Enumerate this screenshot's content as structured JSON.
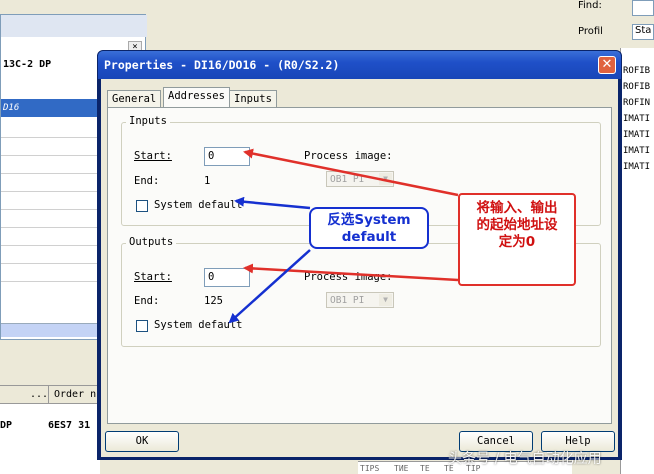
{
  "background": {
    "left_window": {
      "rows": [
        "13C-2 DP",
        "D16"
      ]
    },
    "right_panel": {
      "find_label": "Find:",
      "profile_label": "Profil",
      "profile_value": "Sta",
      "items": [
        "ROFIB",
        "ROFIB",
        "ROFIN",
        "IMATI",
        "IMATI",
        "IMATI",
        "IMATI"
      ]
    },
    "bottom_table": {
      "headers": [
        "...",
        "Order n"
      ],
      "row": [
        "DP",
        "6ES7 31"
      ],
      "extra_row": [
        "TIPS",
        "ТИЕ",
        "ТЕ",
        "ТЕ",
        "TIP"
      ]
    }
  },
  "dialog": {
    "title": "Properties - DI16/DO16 - (R0/S2.2)",
    "tabs": [
      "General",
      "Addresses",
      "Inputs"
    ],
    "active_tab": "Addresses",
    "inputs_group": {
      "label": "Inputs",
      "start_label": "Start:",
      "start_value": "0",
      "end_label": "End:",
      "end_value": "1",
      "process_image_label": "Process image:",
      "process_image_value": "OB1 PI",
      "system_default_label": "System default",
      "system_default_checked": false
    },
    "outputs_group": {
      "label": "Outputs",
      "start_label": "Start:",
      "start_value": "0",
      "end_label": "End:",
      "end_value": "125",
      "process_image_label": "Process image:",
      "process_image_value": "OB1 PI",
      "system_default_label": "System default",
      "system_default_checked": false
    },
    "buttons": {
      "ok": "OK",
      "cancel": "Cancel",
      "help": "Help"
    }
  },
  "annotations": {
    "red_callout": "将输入、输出的起始地址设定为0",
    "blue_callout": "反选System default",
    "red_color": "#e0302a",
    "blue_color": "#1530d0"
  },
  "watermark": "头条号 / 电气自动化应用"
}
